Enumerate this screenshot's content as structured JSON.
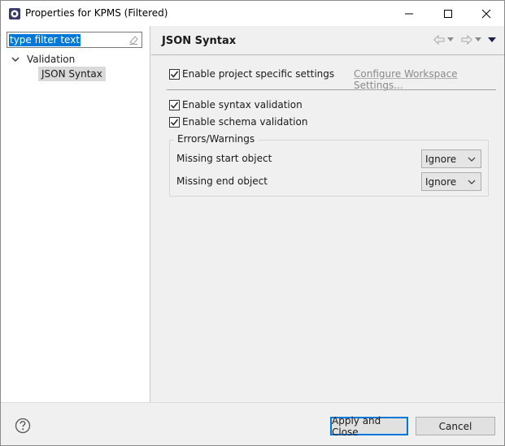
{
  "window": {
    "title": "Properties for KPMS (Filtered)"
  },
  "filter": {
    "text": "type filter text"
  },
  "tree": {
    "category": "Validation",
    "selected_item": "JSON Syntax"
  },
  "page": {
    "title": "JSON Syntax",
    "enable_project_settings": {
      "label": "Enable project specific settings",
      "checked": true
    },
    "configure_link": "Configure Workspace Settings...",
    "enable_syntax_validation": {
      "label": "Enable syntax validation",
      "checked": true
    },
    "enable_schema_validation": {
      "label": "Enable schema validation",
      "checked": true
    },
    "group": {
      "label": "Errors/Warnings",
      "rows": [
        {
          "label": "Missing start object",
          "value": "Ignore"
        },
        {
          "label": "Missing end object",
          "value": "Ignore"
        }
      ]
    }
  },
  "buttons": {
    "apply_close": "Apply and Close",
    "cancel": "Cancel"
  },
  "colors": {
    "accent": "#0078d7",
    "selection": "#0078d7",
    "link_disabled": "#8a8a8a"
  },
  "icons": {
    "app": "properties-gear-icon",
    "back": "back-arrow-icon",
    "forward": "forward-arrow-icon",
    "menu": "view-menu-icon",
    "help": "help-icon",
    "clear": "clear-eraser-icon"
  }
}
